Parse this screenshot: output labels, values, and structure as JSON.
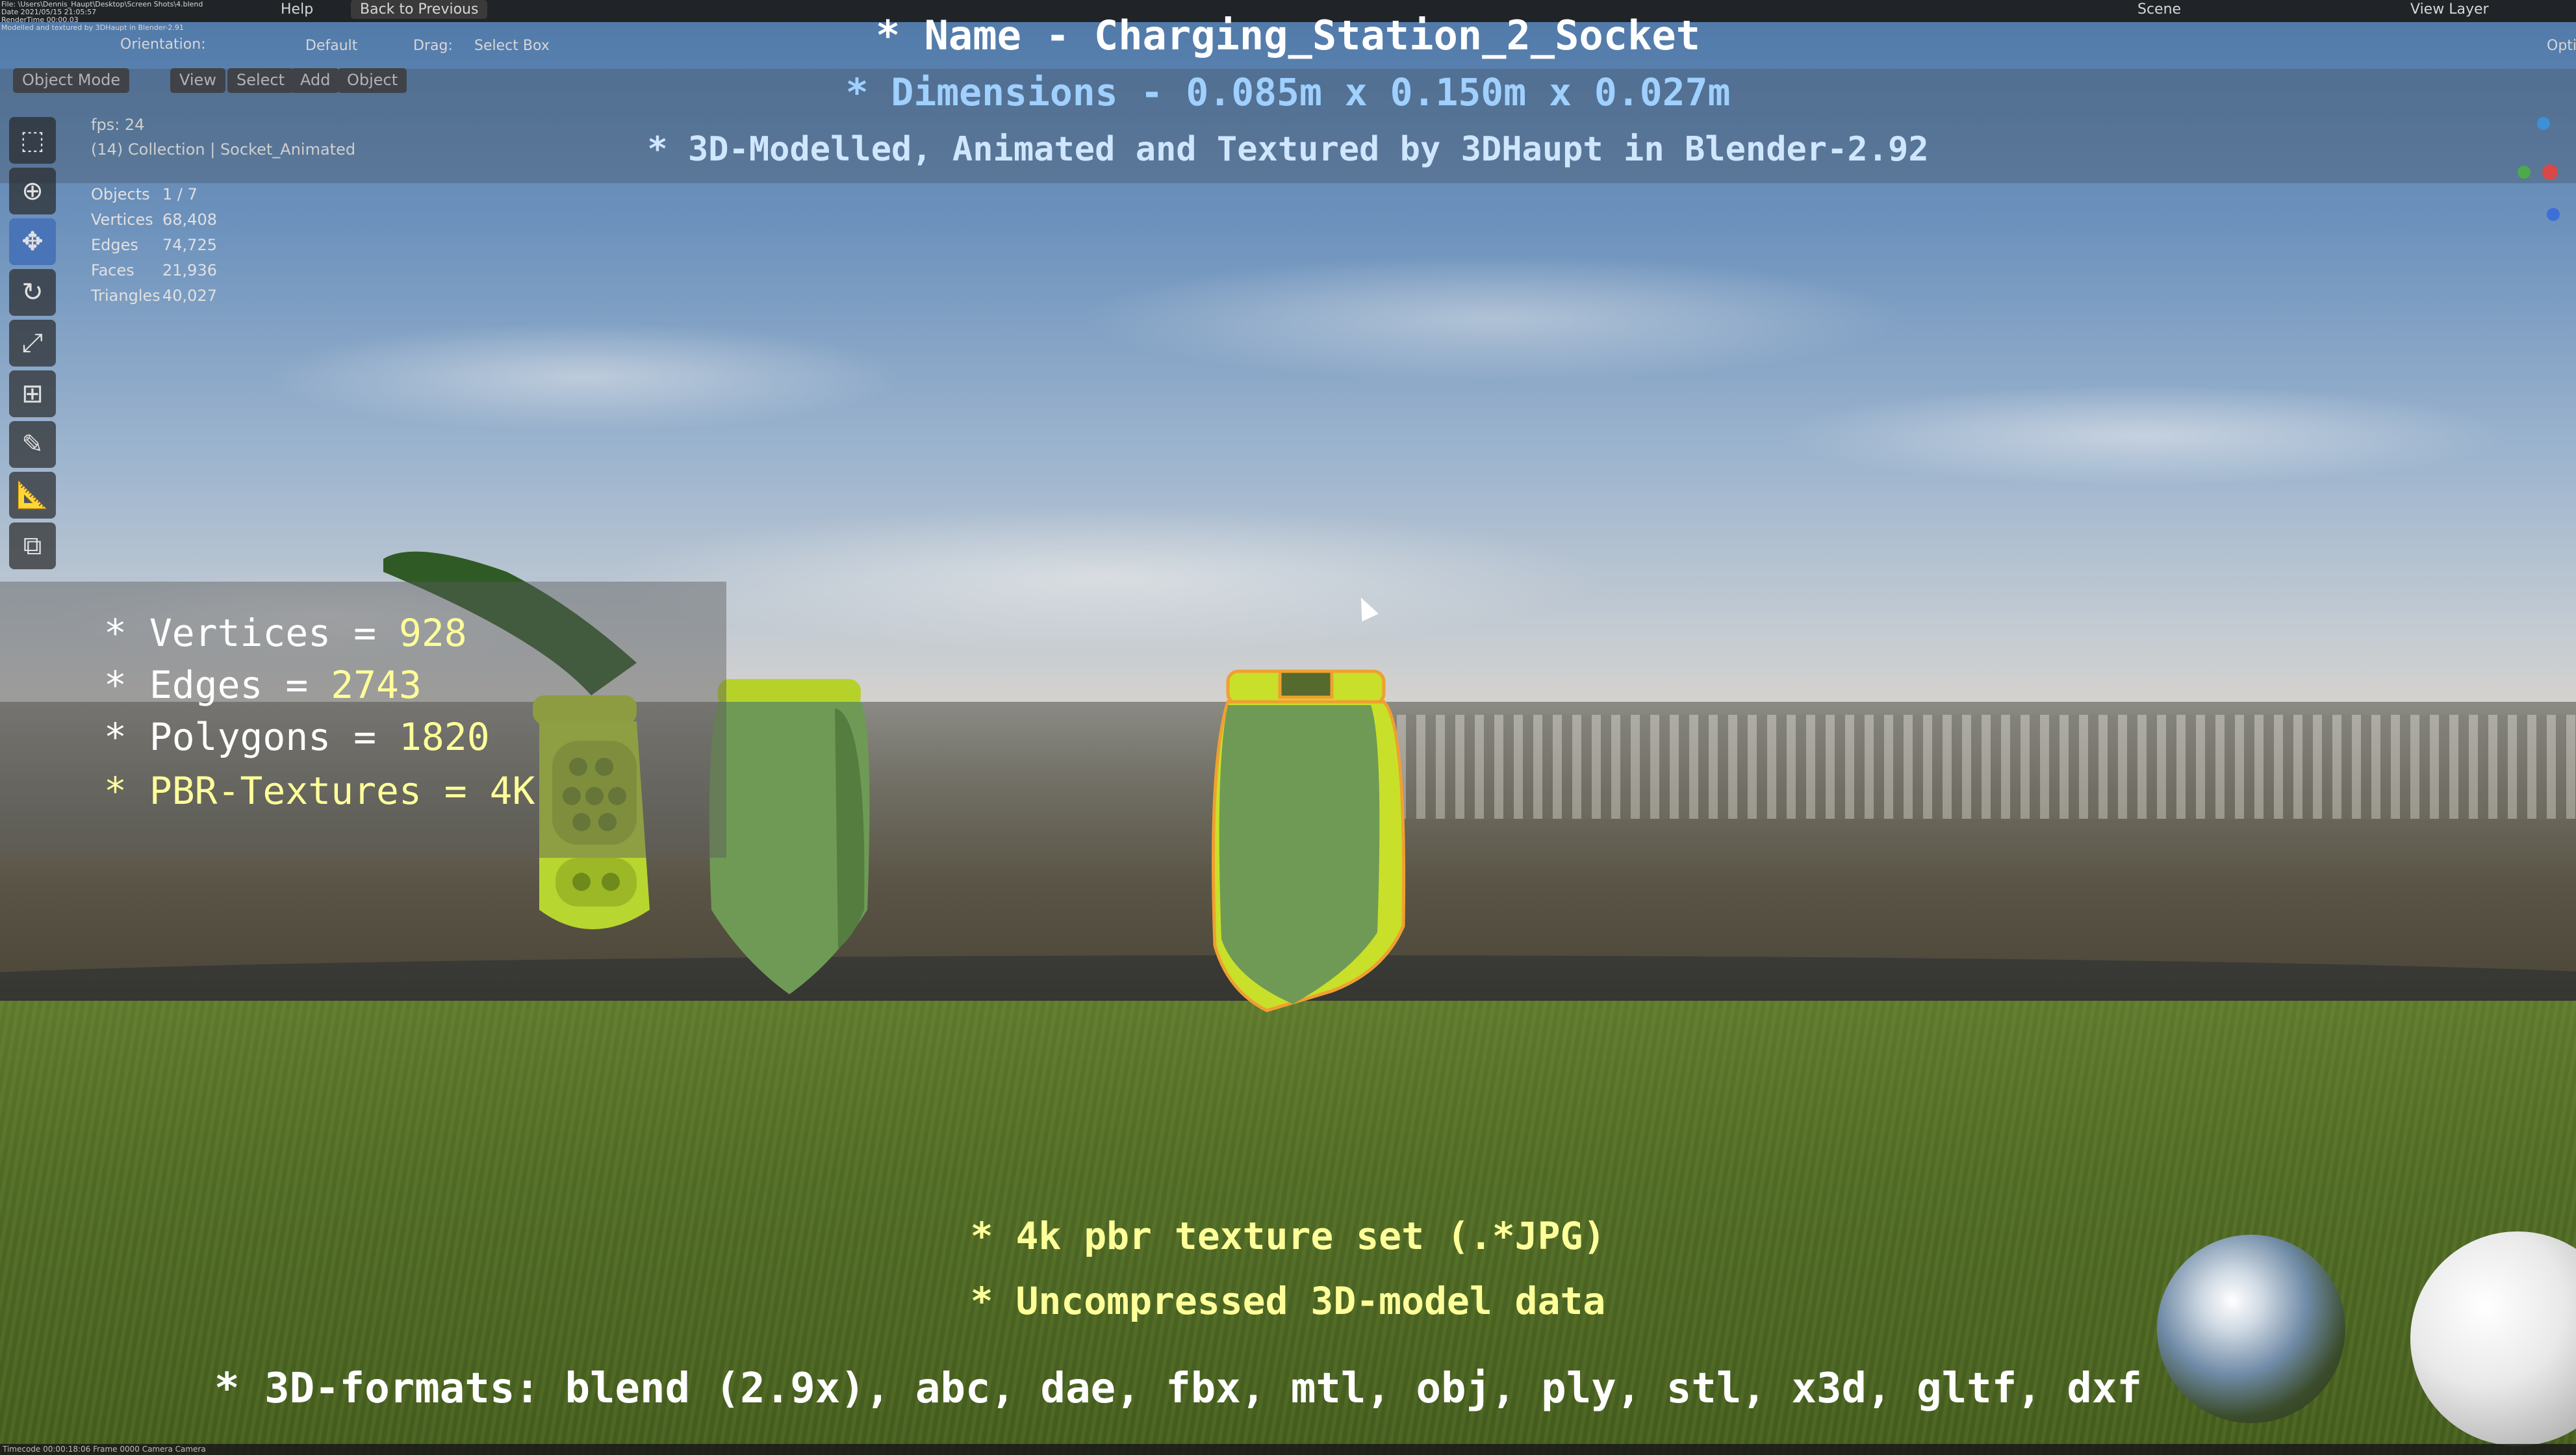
{
  "topbar": {
    "file_path": "File: \\Users\\Dennis_Haupt\\Desktop\\Screen Shots\\4.blend",
    "date": "Date 2021/05/15 21:05:57",
    "render_time": "RenderTime 00:00.03",
    "modelled_by": "Modelled and textured by 3DHaupt in Blender-2.91",
    "help": "Help",
    "back": "Back to Previous",
    "scene": "Scene",
    "view_layer": "View Layer",
    "orientation": "Orientation:",
    "default": "Default",
    "drag_label": "Drag:",
    "select_box": "Select Box",
    "options": "Opti"
  },
  "header": {
    "mode": "Object Mode",
    "view": "View",
    "select": "Select",
    "add": "Add",
    "object": "Object"
  },
  "viewport_info": {
    "fps": "fps: 24",
    "collection": "(14) Collection | Socket_Animated",
    "stats": [
      {
        "label": "Objects",
        "value": "1 / 7"
      },
      {
        "label": "Vertices",
        "value": "68,408"
      },
      {
        "label": "Edges",
        "value": "74,725"
      },
      {
        "label": "Faces",
        "value": "21,936"
      },
      {
        "label": "Triangles",
        "value": "40,027"
      }
    ]
  },
  "overlay": {
    "name": "* Name - Charging_Station_2_Socket",
    "dimensions": "* Dimensions -  0.085m x 0.150m x 0.027m",
    "author": "* 3D-Modelled, Animated and Textured by 3DHaupt in Blender-2.92",
    "info": [
      {
        "label": "* Vertices = ",
        "value": "928"
      },
      {
        "label": "* Edges = ",
        "value": "2743"
      },
      {
        "label": "* Polygons = ",
        "value": "1820"
      },
      {
        "label": "* PBR-Textures = ",
        "value": "4K"
      }
    ],
    "texture_set": "* 4k pbr texture set (.*JPG)",
    "uncompressed": "* Uncompressed 3D-model data",
    "formats": "* 3D-formats: blend (2.9x), abc, dae, fbx, mtl, obj, ply, stl, x3d, gltf, dxf"
  },
  "statusbar": {
    "text": "Timecode 00:00:18:06  Frame 0000  Camera Camera"
  },
  "colors": {
    "title_white": "#ffffff",
    "dims_blue": "#9fd0ff",
    "text_yellow": "#ffff9a",
    "socket_green": "#6f9a55",
    "socket_lime": "#c8e02a",
    "selection_orange": "#f0a030"
  }
}
